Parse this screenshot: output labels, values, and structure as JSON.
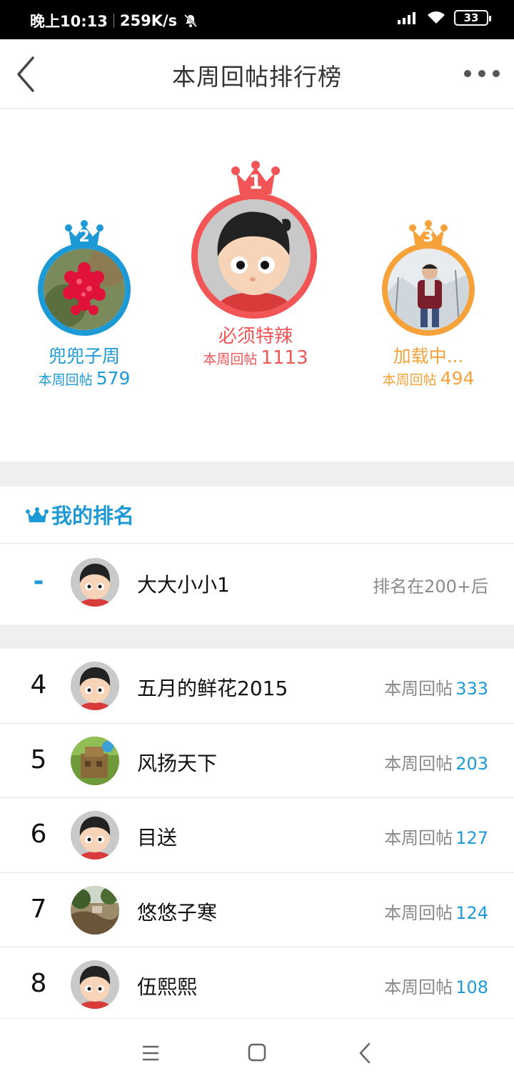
{
  "status_bar": {
    "time": "晚上10:13",
    "speed": "259K/s",
    "battery": "33",
    "icons": [
      "mute-bell-icon",
      "signal-icon",
      "wifi-icon",
      "battery-icon"
    ]
  },
  "header": {
    "title": "本周回帖排行榜",
    "back_icon": "back-chevron-icon",
    "more_icon": "more-dots-icon"
  },
  "colors": {
    "first": "#f25555",
    "second": "#1d9ad6",
    "third": "#f5a23a",
    "accent": "#1d9ad6"
  },
  "podium": {
    "first": {
      "rank": "1",
      "name": "必须特辣",
      "label": "本周回帖",
      "count": "1113"
    },
    "second": {
      "rank": "2",
      "name": "兜兜子周",
      "label": "本周回帖",
      "count": "579"
    },
    "third": {
      "rank": "3",
      "name": "加载中...",
      "label": "本周回帖",
      "count": "494"
    }
  },
  "my_rank": {
    "title": "我的排名",
    "rank": "-",
    "name": "大大小小1",
    "status": "排名在200+后"
  },
  "list": [
    {
      "rank": "4",
      "name": "五月的鲜花2015",
      "label": "本周回帖",
      "count": "333",
      "avatar": "cartoon"
    },
    {
      "rank": "5",
      "name": "风扬天下",
      "label": "本周回帖",
      "count": "203",
      "avatar": "photo-green"
    },
    {
      "rank": "6",
      "name": "目送",
      "label": "本周回帖",
      "count": "127",
      "avatar": "cartoon"
    },
    {
      "rank": "7",
      "name": "悠悠子寒",
      "label": "本周回帖",
      "count": "124",
      "avatar": "photo-nature"
    },
    {
      "rank": "8",
      "name": "伍熙熙",
      "label": "本周回帖",
      "count": "108",
      "avatar": "cartoon"
    }
  ],
  "nav": {
    "icons": [
      "menu-icon",
      "home-square-icon",
      "back-triangle-icon"
    ]
  }
}
